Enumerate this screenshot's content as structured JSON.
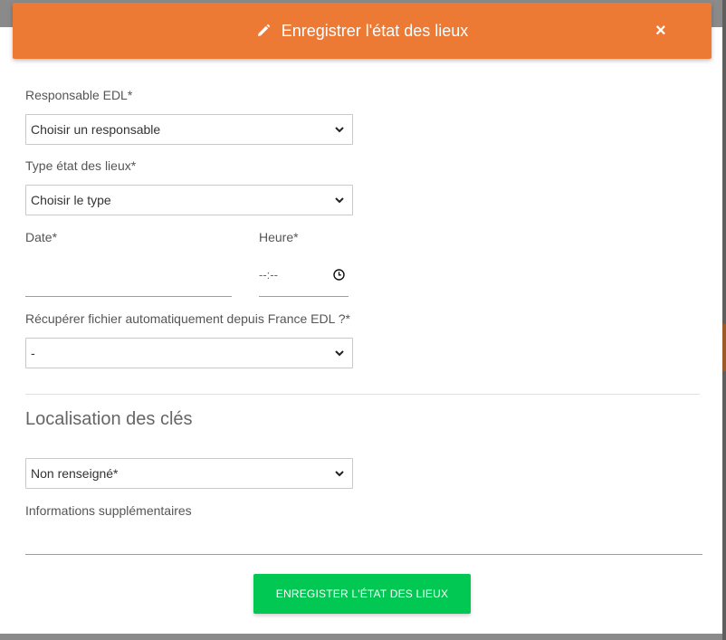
{
  "modal": {
    "title": "Enregistrer l'état des lieux",
    "header_color": "#ec7a34",
    "close_symbol": "×"
  },
  "form": {
    "responsable": {
      "label": "Responsable EDL*",
      "value": "Choisir un responsable"
    },
    "type": {
      "label": "Type état des lieux*",
      "value": "Choisir le type"
    },
    "date": {
      "label": "Date*",
      "value": ""
    },
    "heure": {
      "label": "Heure*",
      "value": "--:--"
    },
    "recuperer": {
      "label": "Récupérer fichier automatiquement depuis France EDL ?*",
      "value": "-"
    },
    "localisation": {
      "title": "Localisation des clés",
      "value": "Non renseigné*"
    },
    "infos": {
      "label": "Informations supplémentaires",
      "value": ""
    }
  },
  "actions": {
    "submit_label": "ENREGISTER L'ÉTAT DES LIEUX",
    "submit_color": "#00c853"
  },
  "icons": [
    "pencil-icon",
    "close-icon",
    "chevron-down-icon",
    "clock-icon"
  ]
}
